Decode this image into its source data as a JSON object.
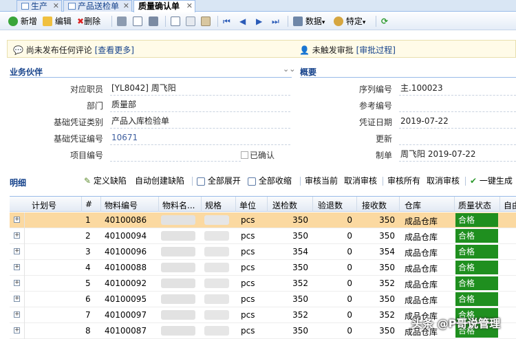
{
  "tabs": [
    {
      "label": "生产",
      "active": false
    },
    {
      "label": "产品送检单",
      "active": false
    },
    {
      "label": "质量确认单",
      "active": true
    }
  ],
  "toolbar": {
    "new_label": "新增",
    "edit_label": "编辑",
    "delete_label": "删除",
    "data_label": "数据",
    "special_label": "特定"
  },
  "notice": {
    "comment_text": "尚未发布任何评论",
    "comment_link": "[查看更多]",
    "approval_text": "未触发审批",
    "approval_link": "[审批过程]"
  },
  "partner": {
    "section_title": "业务伙伴",
    "fields": [
      {
        "label": "对应职员",
        "value": "[YL8042] 周飞阳"
      },
      {
        "label": "部门",
        "value": "质量部"
      },
      {
        "label": "基础凭证类别",
        "value": "产品入库检验单"
      },
      {
        "label": "基础凭证编号",
        "value": "10671"
      },
      {
        "label": "项目编号",
        "value": ""
      }
    ],
    "confirmed_label": "已确认"
  },
  "overview": {
    "section_title": "概要",
    "fields": [
      {
        "label": "序列编号",
        "value": "主.100023"
      },
      {
        "label": "参考编号",
        "value": ""
      },
      {
        "label": "凭证日期",
        "value": "2019-07-22"
      },
      {
        "label": "更新",
        "value": ""
      },
      {
        "label": "制单",
        "value": "周飞阳 2019-07-22"
      }
    ]
  },
  "detail": {
    "title": "明细",
    "actions": {
      "define_defect": "定义缺陷",
      "auto_create_defect": "自动创建缺陷",
      "expand_all": "全部展开",
      "collapse_all": "全部收缩",
      "audit_current": "审核当前",
      "cancel_audit": "取消审核",
      "audit_all": "审核所有",
      "cancel_audit_all": "取消审核",
      "one_key_generate": "一键生成"
    },
    "columns": [
      "计划号",
      "#",
      "物料编号",
      "物料名...",
      "规格",
      "单位",
      "送检数",
      "验退数",
      "接收数",
      "仓库",
      "质量状态",
      "自由"
    ],
    "rows": [
      {
        "plan": "",
        "no": "1",
        "material": "40100086",
        "unit": "pcs",
        "inspect": "350",
        "reject": "0",
        "receive": "350",
        "warehouse": "成品仓库",
        "status": "合格"
      },
      {
        "plan": "",
        "no": "2",
        "material": "40100094",
        "unit": "pcs",
        "inspect": "350",
        "reject": "0",
        "receive": "350",
        "warehouse": "成品仓库",
        "status": "合格"
      },
      {
        "plan": "",
        "no": "3",
        "material": "40100096",
        "unit": "pcs",
        "inspect": "354",
        "reject": "0",
        "receive": "354",
        "warehouse": "成品仓库",
        "status": "合格"
      },
      {
        "plan": "",
        "no": "4",
        "material": "40100088",
        "unit": "pcs",
        "inspect": "350",
        "reject": "0",
        "receive": "350",
        "warehouse": "成品仓库",
        "status": "合格"
      },
      {
        "plan": "",
        "no": "5",
        "material": "40100092",
        "unit": "pcs",
        "inspect": "352",
        "reject": "0",
        "receive": "352",
        "warehouse": "成品仓库",
        "status": "合格"
      },
      {
        "plan": "",
        "no": "6",
        "material": "40100095",
        "unit": "pcs",
        "inspect": "350",
        "reject": "0",
        "receive": "350",
        "warehouse": "成品仓库",
        "status": "合格"
      },
      {
        "plan": "",
        "no": "7",
        "material": "40100097",
        "unit": "pcs",
        "inspect": "352",
        "reject": "0",
        "receive": "352",
        "warehouse": "成品仓库",
        "status": "合格"
      },
      {
        "plan": "",
        "no": "8",
        "material": "40100087",
        "unit": "pcs",
        "inspect": "350",
        "reject": "0",
        "receive": "350",
        "warehouse": "成品仓库",
        "status": "合格"
      }
    ]
  },
  "watermark": "头条 @P哥说管理",
  "colors": {
    "accent": "#15428b",
    "selected_row": "#fbd9a1",
    "status_ok": "#1f8f1f"
  }
}
